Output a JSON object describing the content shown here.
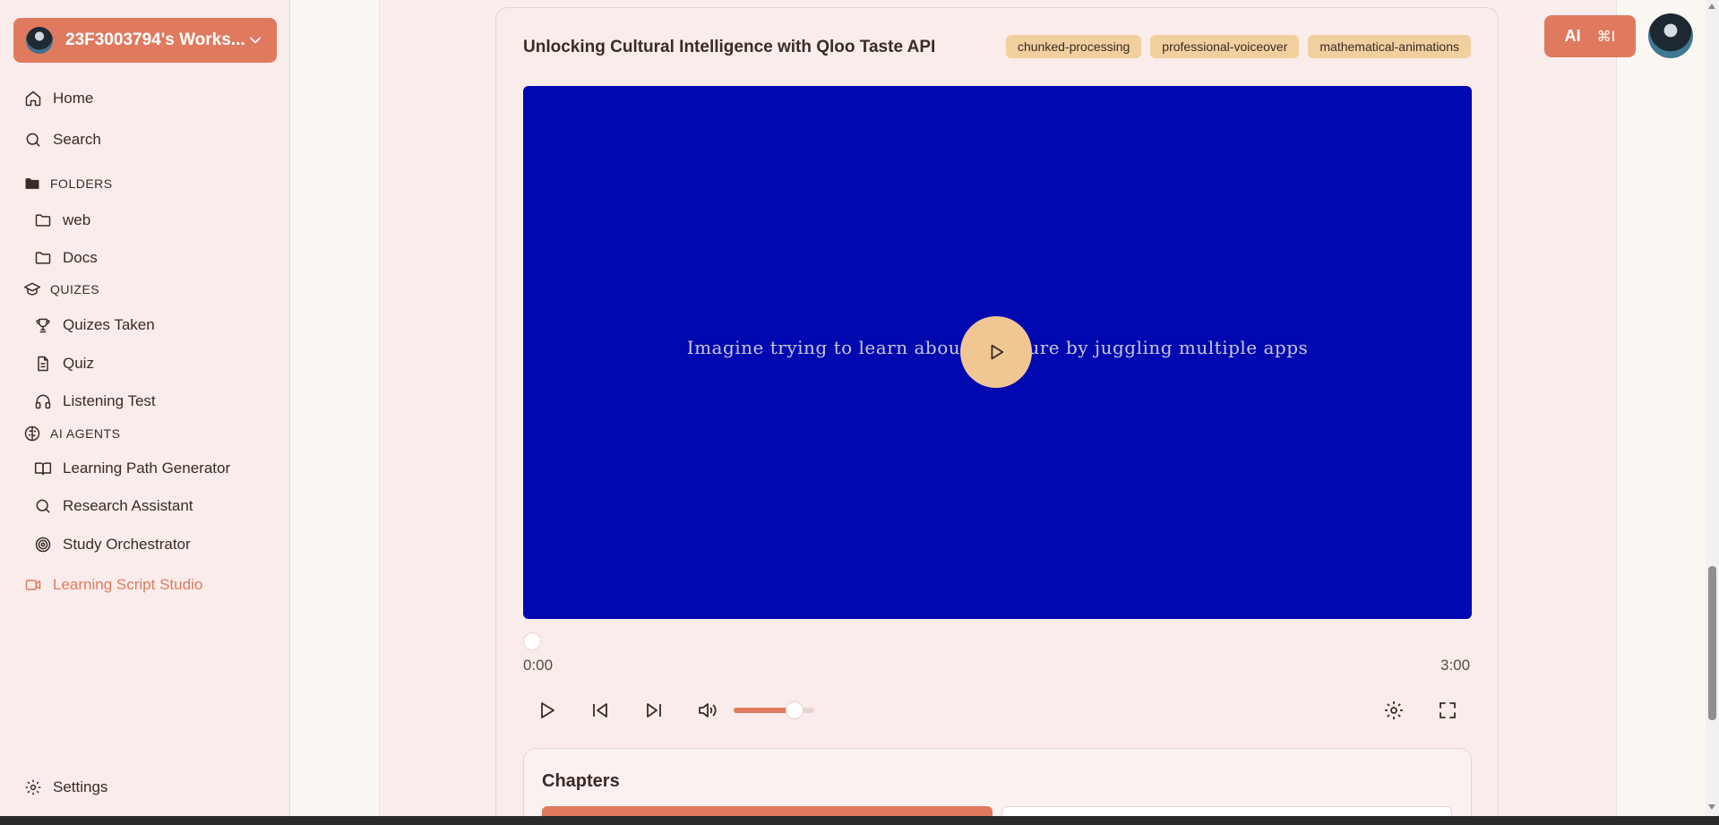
{
  "sidebar": {
    "workspace_label": "23F3003794's Works...",
    "home": "Home",
    "search": "Search",
    "folders_heading": "FOLDERS",
    "folders": [
      "web",
      "Docs"
    ],
    "quizzes_heading": "QUIZES",
    "quizzes": [
      "Quizes Taken",
      "Quiz",
      "Listening Test"
    ],
    "agents_heading": "AI AGENTS",
    "agents": [
      "Learning Path Generator",
      "Research Assistant",
      "Study Orchestrator"
    ],
    "active_item": "Learning Script Studio",
    "settings": "Settings"
  },
  "topbar": {
    "ai_label": "AI",
    "ai_shortcut": "⌘I"
  },
  "video": {
    "title": "Unlocking Cultural Intelligence with Qloo Taste API",
    "tags": [
      "chunked-processing",
      "professional-voiceover",
      "mathematical-animations"
    ],
    "caption": "Imagine trying to learn about a culture by juggling multiple apps",
    "current_time": "0:00",
    "duration": "3:00",
    "progress": 0,
    "volume": 0.75
  },
  "chapters": {
    "title": "Chapters"
  },
  "colors": {
    "accent": "#e07a5f",
    "video_bg": "#0008b0",
    "tag_bg": "#f1cf9f"
  }
}
